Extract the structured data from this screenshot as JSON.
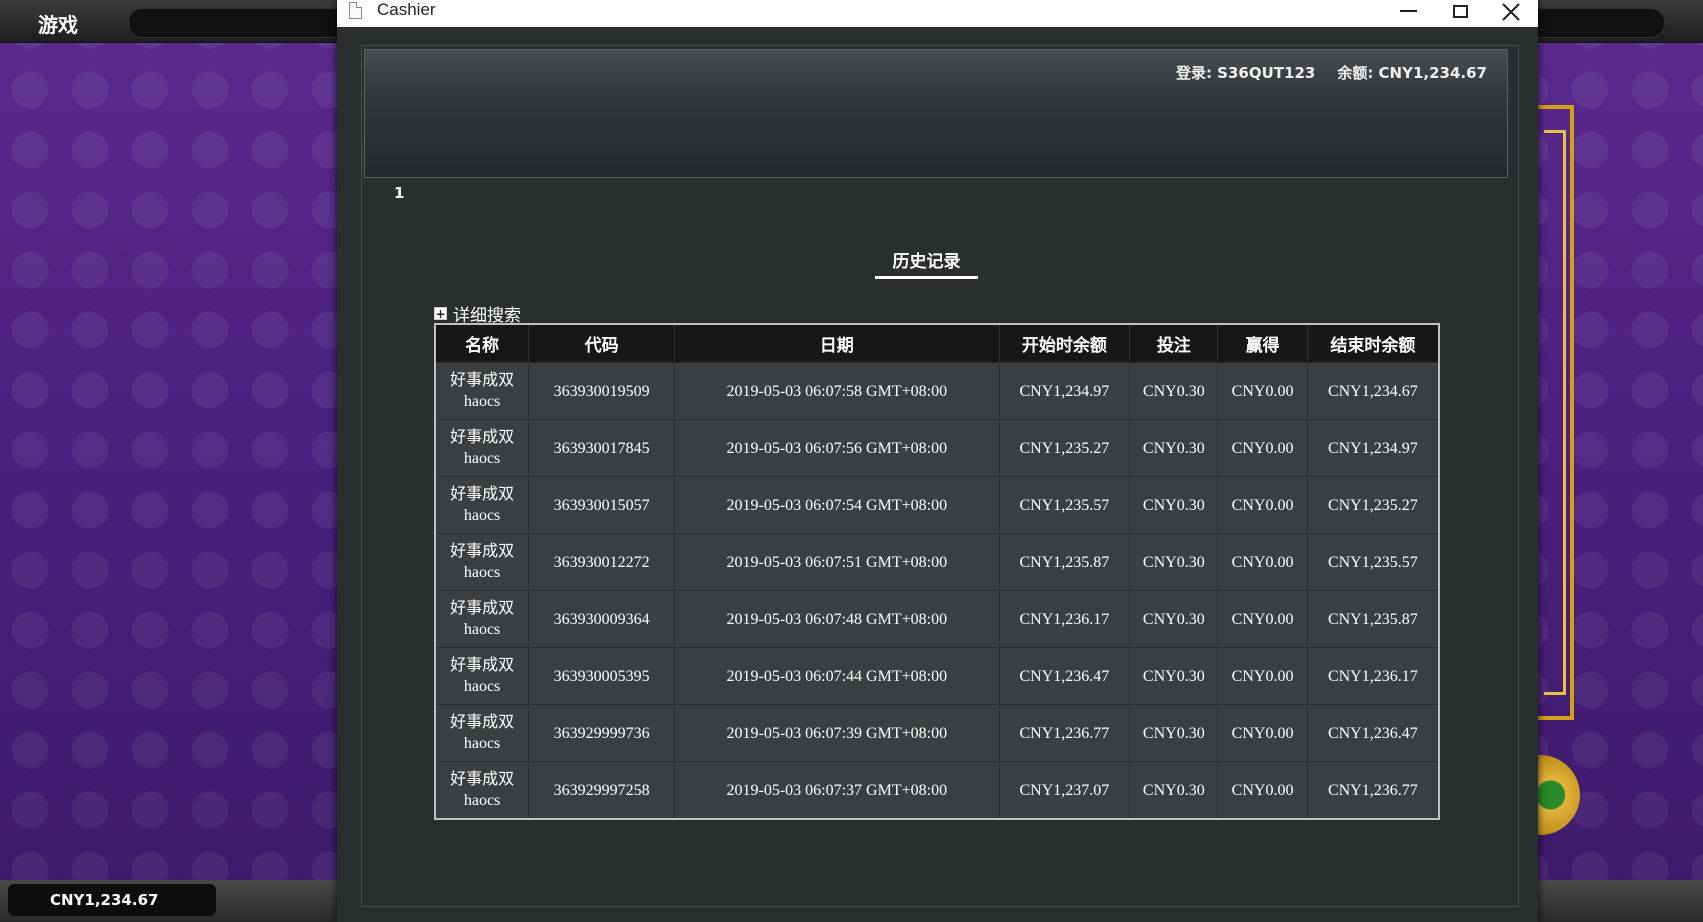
{
  "game": {
    "title": "游戏",
    "balance": "CNY1,234.67"
  },
  "window": {
    "title": "Cashier",
    "controls": {
      "minimize": "minimize",
      "maximize": "maximize",
      "close": "close"
    }
  },
  "header": {
    "login": "登录: S36QUT123",
    "balance": "余额: CNY1,234.67"
  },
  "page_number": "1",
  "history_tab": "历史记录",
  "advanced_search": "详细搜索",
  "table": {
    "columns": [
      "名称",
      "代码",
      "日期",
      "开始时余额",
      "投注",
      "赢得",
      "结束时余额"
    ],
    "rows": [
      {
        "name_cn": "好事成双",
        "name_en": "haocs",
        "code": "363930019509",
        "date": "2019-05-03 06:07:58 GMT+08:00",
        "start_balance": "CNY1,234.97",
        "bet": "CNY0.30",
        "win": "CNY0.00",
        "end_balance": "CNY1,234.67"
      },
      {
        "name_cn": "好事成双",
        "name_en": "haocs",
        "code": "363930017845",
        "date": "2019-05-03 06:07:56 GMT+08:00",
        "start_balance": "CNY1,235.27",
        "bet": "CNY0.30",
        "win": "CNY0.00",
        "end_balance": "CNY1,234.97"
      },
      {
        "name_cn": "好事成双",
        "name_en": "haocs",
        "code": "363930015057",
        "date": "2019-05-03 06:07:54 GMT+08:00",
        "start_balance": "CNY1,235.57",
        "bet": "CNY0.30",
        "win": "CNY0.00",
        "end_balance": "CNY1,235.27"
      },
      {
        "name_cn": "好事成双",
        "name_en": "haocs",
        "code": "363930012272",
        "date": "2019-05-03 06:07:51 GMT+08:00",
        "start_balance": "CNY1,235.87",
        "bet": "CNY0.30",
        "win": "CNY0.00",
        "end_balance": "CNY1,235.57"
      },
      {
        "name_cn": "好事成双",
        "name_en": "haocs",
        "code": "363930009364",
        "date": "2019-05-03 06:07:48 GMT+08:00",
        "start_balance": "CNY1,236.17",
        "bet": "CNY0.30",
        "win": "CNY0.00",
        "end_balance": "CNY1,235.87"
      },
      {
        "name_cn": "好事成双",
        "name_en": "haocs",
        "code": "363930005395",
        "date": "2019-05-03 06:07:44 GMT+08:00",
        "start_balance": "CNY1,236.47",
        "bet": "CNY0.30",
        "win": "CNY0.00",
        "end_balance": "CNY1,236.17"
      },
      {
        "name_cn": "好事成双",
        "name_en": "haocs",
        "code": "363929999736",
        "date": "2019-05-03 06:07:39 GMT+08:00",
        "start_balance": "CNY1,236.77",
        "bet": "CNY0.30",
        "win": "CNY0.00",
        "end_balance": "CNY1,236.47"
      },
      {
        "name_cn": "好事成双",
        "name_en": "haocs",
        "code": "363929997258",
        "date": "2019-05-03 06:07:37 GMT+08:00",
        "start_balance": "CNY1,237.07",
        "bet": "CNY0.30",
        "win": "CNY0.00",
        "end_balance": "CNY1,236.77"
      }
    ]
  }
}
